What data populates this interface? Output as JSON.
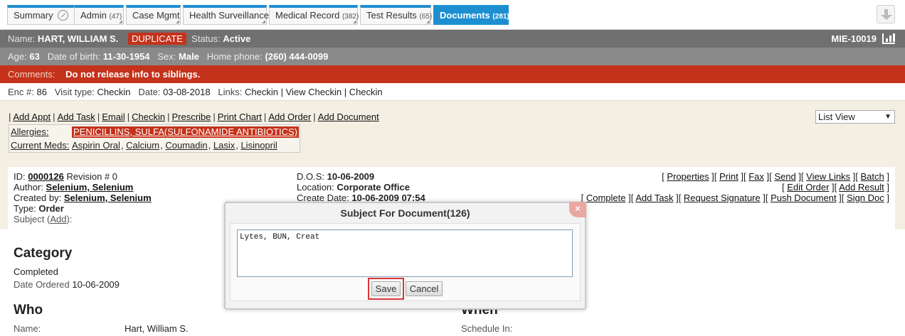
{
  "tabs": [
    {
      "label": "Summary",
      "count": ""
    },
    {
      "label": "Admin",
      "count": "(47)"
    },
    {
      "label": "Case Mgmt",
      "count": ""
    },
    {
      "label": "Health Surveillance",
      "count": ""
    },
    {
      "label": "Medical Record",
      "count": "(382)"
    },
    {
      "label": "Test Results",
      "count": "(65)"
    },
    {
      "label": "Documents",
      "count": "(281)"
    }
  ],
  "patient": {
    "name_label": "Name:",
    "name": "HART, WILLIAM S.",
    "duplicate": "DUPLICATE",
    "status_label": "Status:",
    "status": "Active",
    "mrn": "MIE-10019",
    "age_label": "Age:",
    "age": "63",
    "dob_label": "Date of birth:",
    "dob": "11-30-1954",
    "sex_label": "Sex:",
    "sex": "Male",
    "phone_label": "Home phone:",
    "phone": "(260) 444-0099",
    "comments_label": "Comments:",
    "comments": "Do not release info to siblings."
  },
  "encounter": {
    "enc_label": "Enc #:",
    "enc": "86",
    "visit_label": "Visit type:",
    "visit": "Checkin",
    "date_label": "Date:",
    "date": "03-08-2018",
    "links_label": "Links:",
    "links": "Checkin | View Checkin | Checkin"
  },
  "actions": [
    "Add Appt",
    "Add Task",
    "Email",
    "Checkin",
    "Prescribe",
    "Print Chart",
    "Add Order",
    "Add Document"
  ],
  "view_select": "List View",
  "allergies": {
    "label": "Allergies:",
    "value": "PENICILLINS, SULFA(SULFONAMIDE ANTIBIOTICS)",
    "meds_label": "Current Meds:",
    "meds": [
      "Aspirin Oral",
      "Calcium",
      "Coumadin",
      "Lasix",
      "Lisinopril"
    ]
  },
  "document": {
    "id_label": "ID:",
    "id": "0000126",
    "revision": "Revision # 0",
    "author_label": "Author:",
    "author": "Selenium, Selenium",
    "created_label": "Created by:",
    "created_by": "Selenium, Selenium",
    "type_label": "Type:",
    "type": "Order",
    "subject_label": "Subject (",
    "subject_add": "Add",
    "subject_tail": "):",
    "dos_label": "D.O.S:",
    "dos": "10-06-2009",
    "location_label": "Location:",
    "location": "Corporate Office",
    "create_date_label": "Create Date:",
    "create_date": "10-06-2009 07:54",
    "links_row1": [
      "Properties",
      "Print",
      "Fax",
      "Send",
      "View Links",
      "Batch"
    ],
    "links_row2": [
      "Edit Order",
      "Add Result"
    ],
    "links_row3": [
      "Complete",
      "Add Task",
      "Request Signature",
      "Push Document",
      "Sign Doc"
    ]
  },
  "details": {
    "category_heading": "Category",
    "status": "Completed",
    "date_ordered_label": "Date Ordered",
    "date_ordered": "10-06-2009",
    "who_heading": "Who",
    "when_heading": "When",
    "name_label": "Name:",
    "name": "Hart, William S.",
    "schedule_label": "Schedule In:"
  },
  "modal": {
    "title": "Subject For Document(126)",
    "close": "×",
    "text": "Lytes, BUN, Creat",
    "save": "Save",
    "cancel": "Cancel"
  }
}
